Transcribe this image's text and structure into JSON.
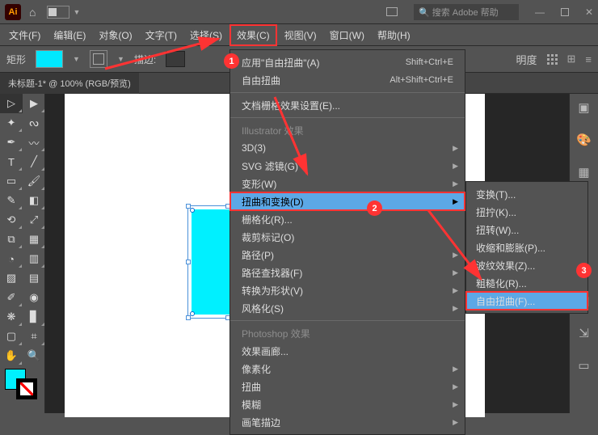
{
  "app": {
    "logo_text": "Ai"
  },
  "titlebar": {
    "home_icon": "⌂",
    "search_placeholder": "搜索 Adobe 帮助",
    "search_icon": "🔍"
  },
  "menubar": {
    "file": "文件(F)",
    "edit": "编辑(E)",
    "object": "对象(O)",
    "type": "文字(T)",
    "select": "选择(S)",
    "effect": "效果(C)",
    "view": "视图(V)",
    "window": "窗口(W)",
    "help": "帮助(H)"
  },
  "controlbar": {
    "shape_label": "矩形",
    "stroke_label": "描边:",
    "opacity_label": "明度",
    "fill_color": "#00e8ff"
  },
  "doc_tab": "未标题-1* @ 100% (RGB/预览)",
  "effects_menu": {
    "apply_last": "应用\"自由扭曲\"(A)",
    "apply_last_sc": "Shift+Ctrl+E",
    "free_distort": "自由扭曲",
    "free_distort_sc": "Alt+Shift+Ctrl+E",
    "doc_raster": "文档栅格效果设置(E)...",
    "header_ai": "Illustrator 效果",
    "three_d": "3D(3)",
    "svg_filter": "SVG 滤镜(G)",
    "warp": "变形(W)",
    "distort_transform": "扭曲和变换(D)",
    "rasterize": "栅格化(R)...",
    "crop_marks": "裁剪标记(O)",
    "path": "路径(P)",
    "pathfinder": "路径查找器(F)",
    "convert_shape": "转换为形状(V)",
    "stylize": "风格化(S)",
    "header_ps": "Photoshop 效果",
    "effect_gallery": "效果画廊...",
    "pixelate": "像素化",
    "distort2": "扭曲",
    "blur": "模糊",
    "brush_strokes": "画笔描边"
  },
  "submenu": {
    "transform": "变换(T)...",
    "tweak": "扭拧(K)...",
    "twist": "扭转(W)...",
    "pucker": "收缩和膨胀(P)...",
    "zigzag": "波纹效果(Z)...",
    "roughen": "粗糙化(R)...",
    "free_distort": "自由扭曲(F)..."
  },
  "badges": {
    "b1": "1",
    "b2": "2",
    "b3": "3"
  },
  "chart_data": {
    "type": "shape",
    "object": "rectangle",
    "fill": "#00f0ff",
    "stroke": "none",
    "approx_size_px": {
      "width": 92,
      "height": 132
    },
    "selected": true
  }
}
